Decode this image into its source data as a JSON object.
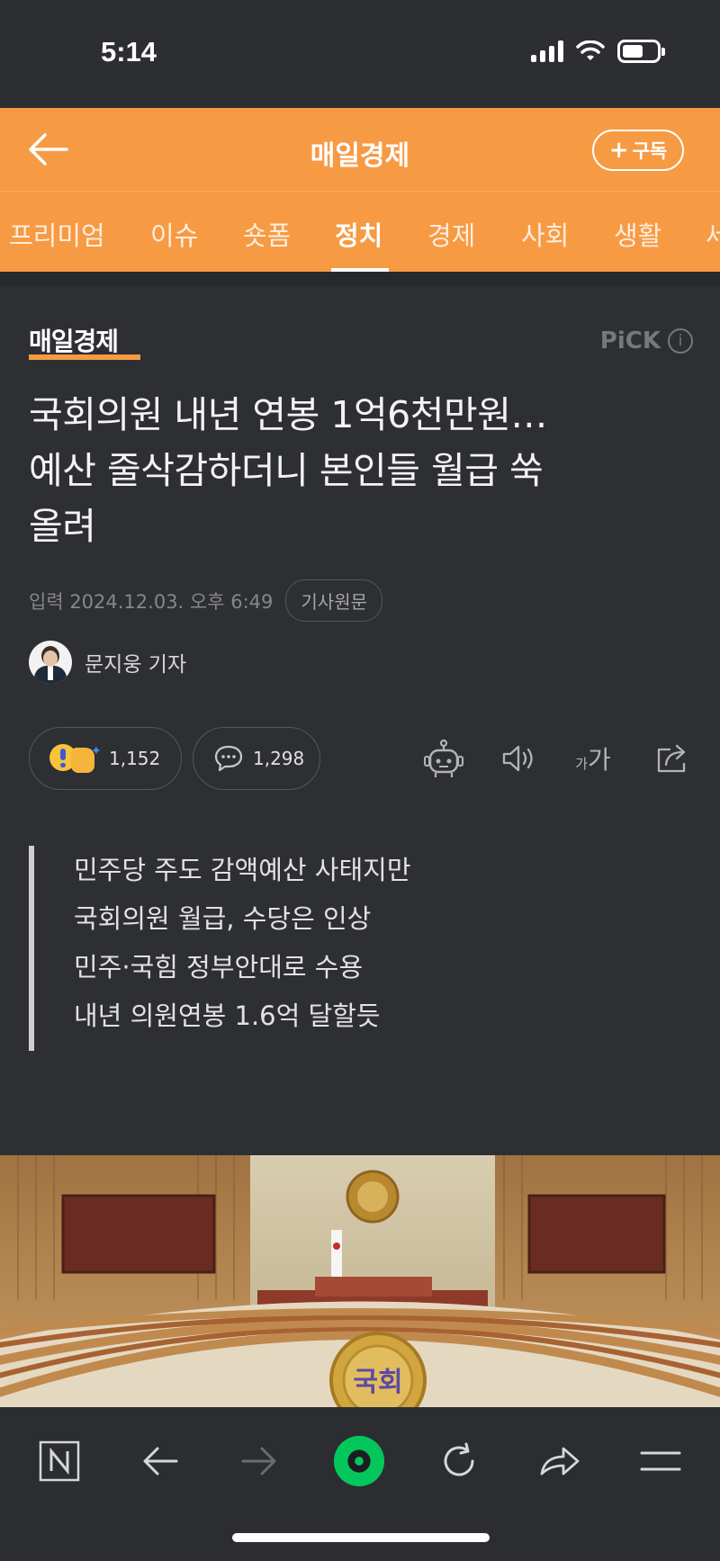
{
  "status_bar": {
    "time": "5:14"
  },
  "header": {
    "title": "매일경제",
    "subscribe_label": "구독"
  },
  "tabs": [
    {
      "label": "프리미엄",
      "active": false
    },
    {
      "label": "이슈",
      "active": false
    },
    {
      "label": "숏폼",
      "active": false
    },
    {
      "label": "정치",
      "active": true
    },
    {
      "label": "경제",
      "active": false
    },
    {
      "label": "사회",
      "active": false
    },
    {
      "label": "생활",
      "active": false
    },
    {
      "label": "세",
      "active": false
    }
  ],
  "article": {
    "press_name": "매일경제",
    "pick_label": "PiCK",
    "headline_lines": [
      "국회의원 내년 연봉 1억6천만원…",
      "예산 줄삭감하더니 본인들 월급 쑥",
      "올려"
    ],
    "date_text": "입력 2024.12.03. 오후 6:49",
    "original_link_label": "기사원문",
    "reporter": "문지웅 기자",
    "reaction_count": "1,152",
    "comment_count": "1,298",
    "font_size_label_small": "가",
    "font_size_label_big": "가",
    "summary": [
      "민주당 주도 감액예산 사태지만",
      "국회의원 월급, 수당은 인상",
      "민주·국힘 정부안대로 수용",
      "내년 의원연봉 1.6억 달할듯"
    ],
    "photo_emblem_text": "국회"
  },
  "colors": {
    "accent": "#f79a44",
    "background": "#2e2f33",
    "naver_green": "#03c75a"
  },
  "icons": [
    "back-arrow-icon",
    "plus-icon",
    "info-icon",
    "reaction-icon",
    "comment-icon",
    "robot-summary-icon",
    "speaker-icon",
    "font-size-icon",
    "share-icon",
    "naver-n-icon",
    "browser-back-icon",
    "browser-forward-icon",
    "naver-green-home-icon",
    "refresh-icon",
    "forward-share-icon",
    "menu-icon"
  ]
}
